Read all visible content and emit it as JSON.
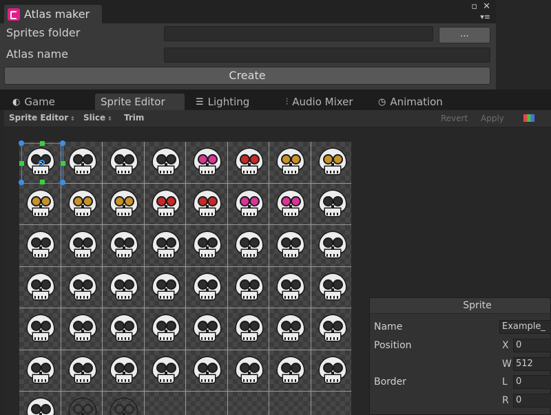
{
  "atlas_window": {
    "tab_title": "Atlas maker",
    "fields": [
      {
        "label": "Sprites folder",
        "value": ""
      },
      {
        "label": "Atlas name",
        "value": ""
      }
    ],
    "browse_label": "...",
    "create_label": "Create",
    "menu_glyph": "▾≡"
  },
  "editor_tabs": [
    {
      "label": "Game",
      "icon": "game-icon",
      "glyph": "◐"
    },
    {
      "label": "Sprite Editor",
      "icon": "",
      "glyph": ""
    },
    {
      "label": "Lighting",
      "icon": "lighting-icon",
      "glyph": "☰"
    },
    {
      "label": "Audio Mixer",
      "icon": "audio-mixer-icon",
      "glyph": "⫶"
    },
    {
      "label": "Animation",
      "icon": "animation-icon",
      "glyph": "◷"
    }
  ],
  "toolbar": {
    "mode_label": "Sprite Editor",
    "slice_label": "Slice",
    "trim_label": "Trim",
    "revert_label": "Revert",
    "apply_label": "Apply"
  },
  "sprite_sheet": {
    "rows": [
      [
        "#2e2e2e",
        "#2e2e2e",
        "#2e2e2e",
        "#2e2e2e",
        "#d8359a",
        "#c82828",
        "#c8922a",
        "#c8922a"
      ],
      [
        "#c8922a",
        "#c8922a",
        "#c8922a",
        "#c82828",
        "#c82828",
        "#d8359a",
        "#d8359a",
        "#2e2e2e"
      ],
      [
        "#2e2e2e",
        "#2e2e2e",
        "#2e2e2e",
        "#2e2e2e",
        "#2e2e2e",
        "#2e2e2e",
        "#2e2e2e",
        "#2e2e2e"
      ],
      [
        "#2e2e2e",
        "#2e2e2e",
        "#2e2e2e",
        "#2e2e2e",
        "#2e2e2e",
        "#2e2e2e",
        "#2e2e2e",
        "#2e2e2e"
      ],
      [
        "#2e2e2e",
        "#2e2e2e",
        "#2e2e2e",
        "#2e2e2e",
        "#2e2e2e",
        "#2e2e2e",
        "#2e2e2e",
        "#2e2e2e"
      ],
      [
        "#2e2e2e",
        "#2e2e2e",
        "#2e2e2e",
        "#2e2e2e",
        "#2e2e2e",
        "#2e2e2e",
        "#2e2e2e",
        "#2e2e2e"
      ],
      [
        "#2e2e2e",
        "ghost",
        "ghost",
        "",
        "",
        "",
        "",
        ""
      ]
    ]
  },
  "sprite_panel": {
    "title": "Sprite",
    "name_label": "Name",
    "name_value": "Example_",
    "position_label": "Position",
    "x_axis": "X",
    "x_value": "0",
    "w_axis": "W",
    "w_value": "512",
    "border_label": "Border",
    "l_axis": "L",
    "l_value": "0",
    "r_axis": "R",
    "r_value": "0"
  }
}
